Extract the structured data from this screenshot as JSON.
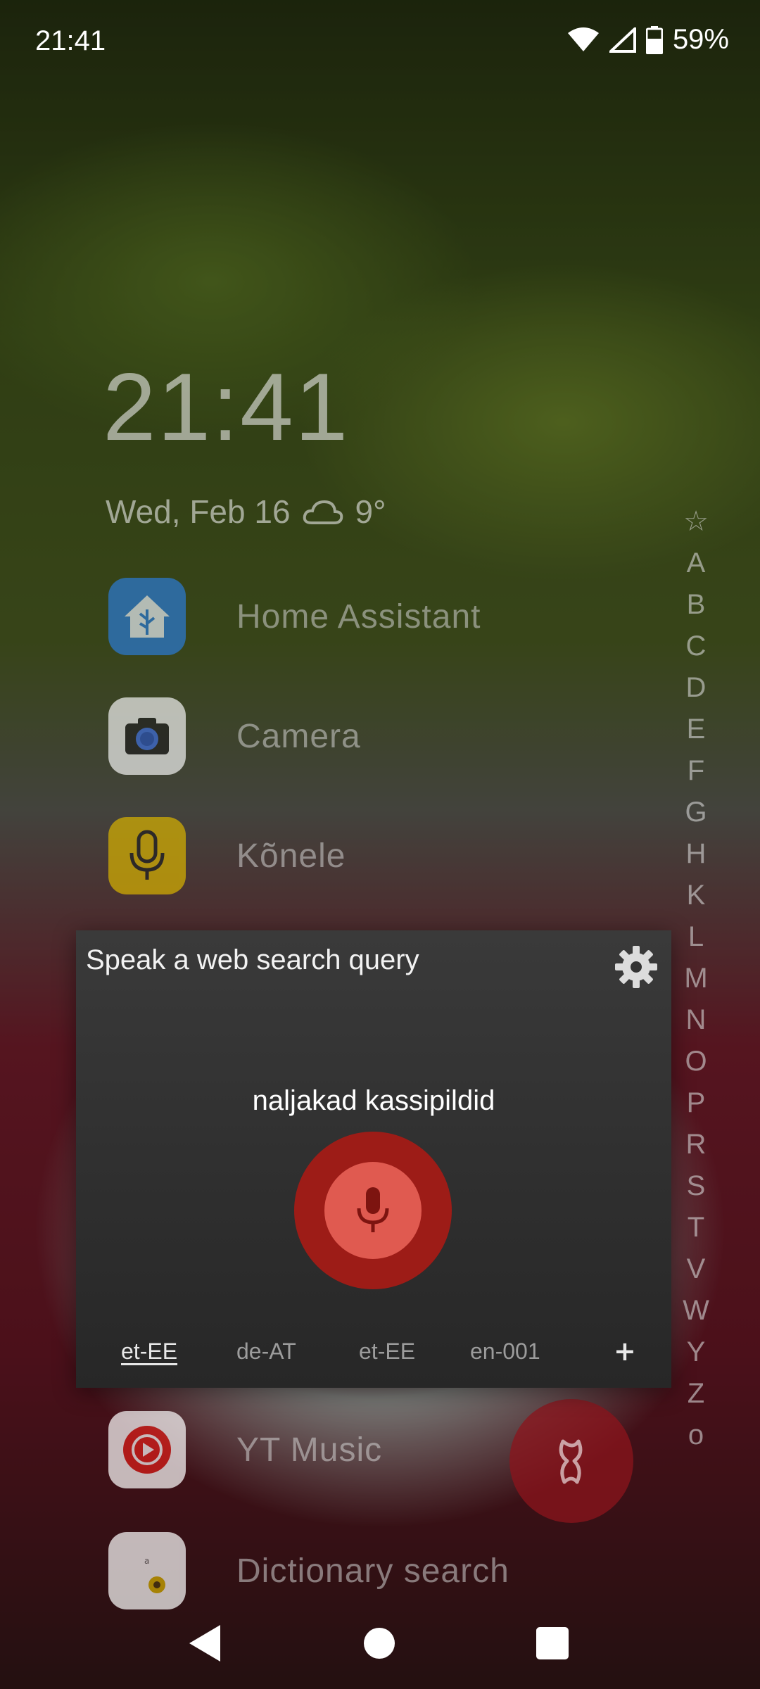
{
  "status_bar": {
    "time": "21:41",
    "battery": "59%"
  },
  "clock_widget": {
    "time": "21:41",
    "date": "Wed, Feb 16",
    "temperature": "9°",
    "weather_icon": "cloud-icon"
  },
  "apps": [
    {
      "label": "Home Assistant",
      "icon": "home-assistant-icon",
      "color": "#2b7bd6"
    },
    {
      "label": "Camera",
      "icon": "camera-icon",
      "color": "#f2f2f2"
    },
    {
      "label": "Kõnele",
      "icon": "microphone-icon",
      "color": "#d9b300"
    },
    {
      "label": "YT Music",
      "icon": "yt-music-icon",
      "color": "#ffffff"
    },
    {
      "label": "Dictionary search",
      "icon": "dictionary-icon",
      "color": "#ffffff"
    }
  ],
  "alphabet": [
    "☆",
    "A",
    "B",
    "C",
    "D",
    "E",
    "F",
    "G",
    "H",
    "K",
    "L",
    "M",
    "N",
    "O",
    "P",
    "R",
    "S",
    "T",
    "V",
    "W",
    "Y",
    "Z",
    "o"
  ],
  "dialog": {
    "title": "Speak a web search query",
    "transcript": "naljakad kassipildid",
    "languages": [
      "et-EE",
      "de-AT",
      "et-EE",
      "en-001"
    ],
    "active_language_index": 0,
    "add_label": "+"
  },
  "colors": {
    "mic_outer": "#9d1c17",
    "mic_inner": "#e05a50",
    "dialog_bg": "#333333"
  }
}
